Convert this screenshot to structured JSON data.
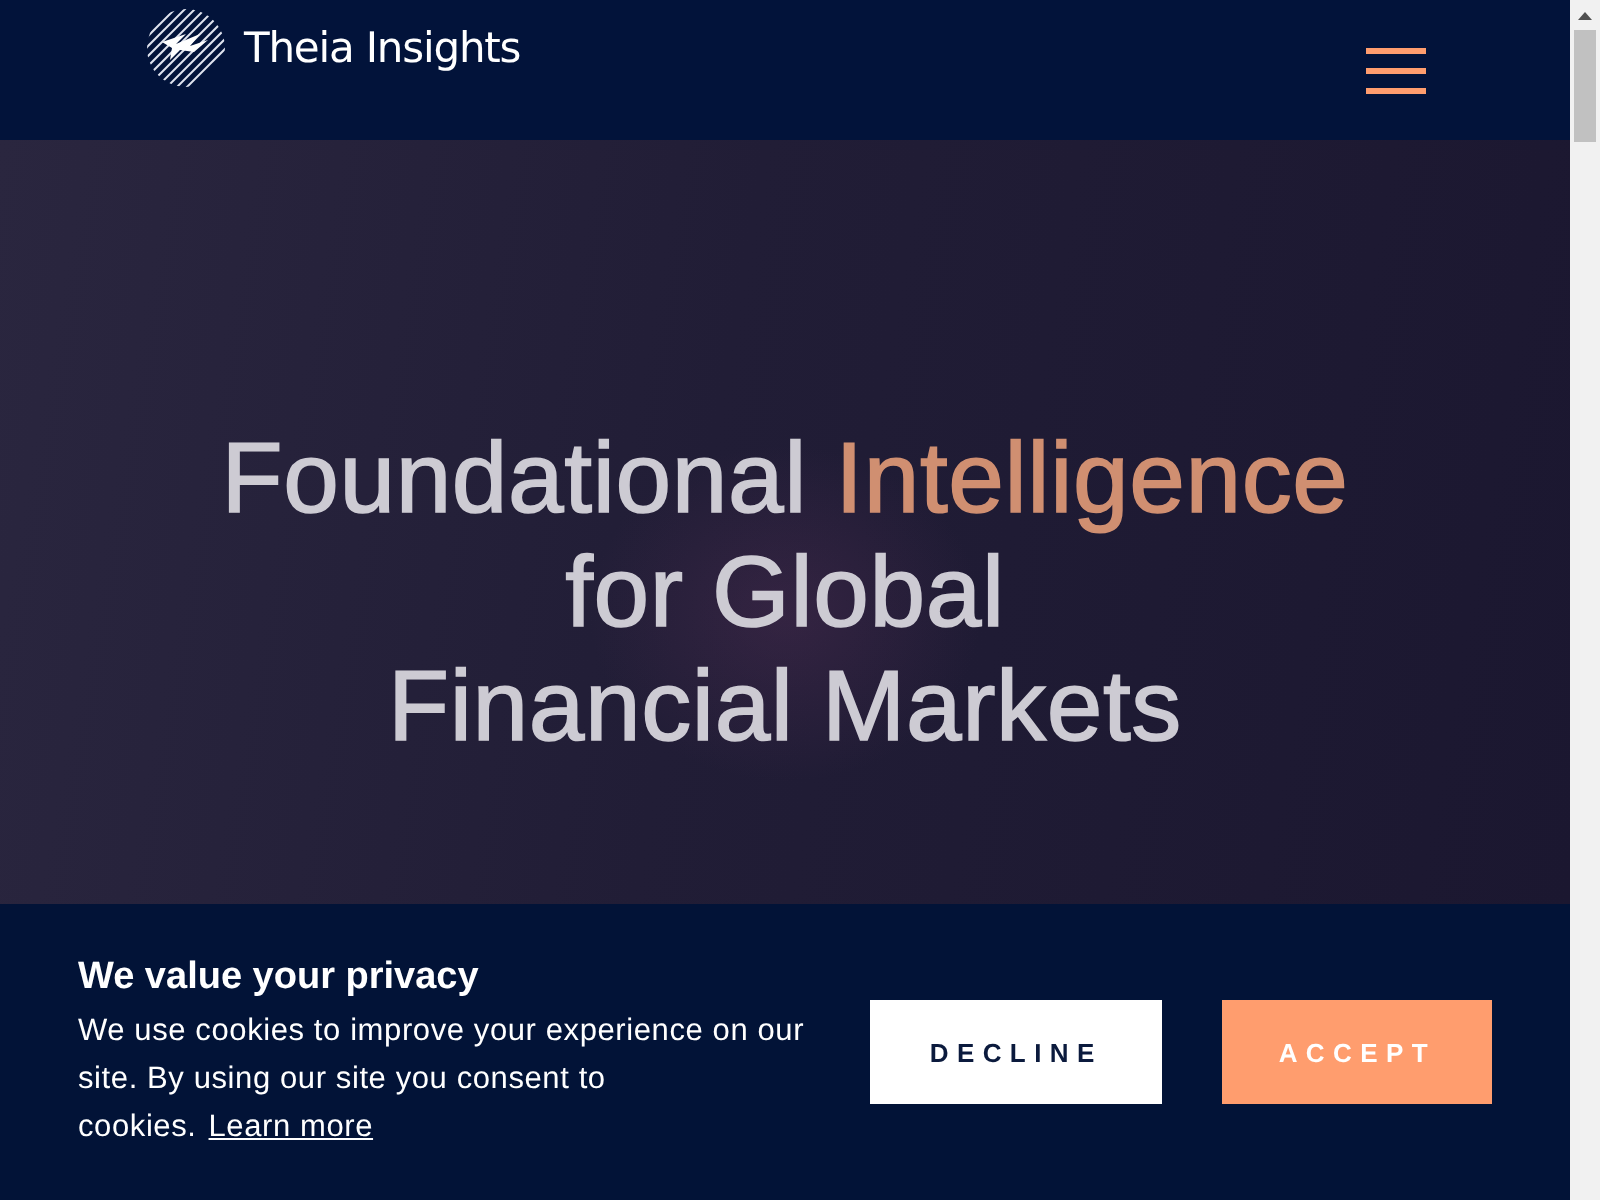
{
  "header": {
    "logo_text": "Theia Insights"
  },
  "hero": {
    "heading": {
      "lines": [
        {
          "parts": [
            {
              "text": "Foundational ",
              "accent": false
            },
            {
              "text": "Intelligence",
              "accent": true
            }
          ]
        },
        {
          "parts": [
            {
              "text": "for Global",
              "accent": false
            }
          ]
        },
        {
          "parts": [
            {
              "text": "Financial Markets",
              "accent": false
            }
          ]
        }
      ]
    }
  },
  "cookie_banner": {
    "title": "We value your privacy",
    "body": "We use cookies to improve your experience on our site. By using our site you consent to cookies.",
    "link": "Learn more",
    "buttons": [
      {
        "label": "DECLINE",
        "kind": "secondary"
      },
      {
        "label": "ACCEPT",
        "kind": "primary"
      }
    ]
  }
}
